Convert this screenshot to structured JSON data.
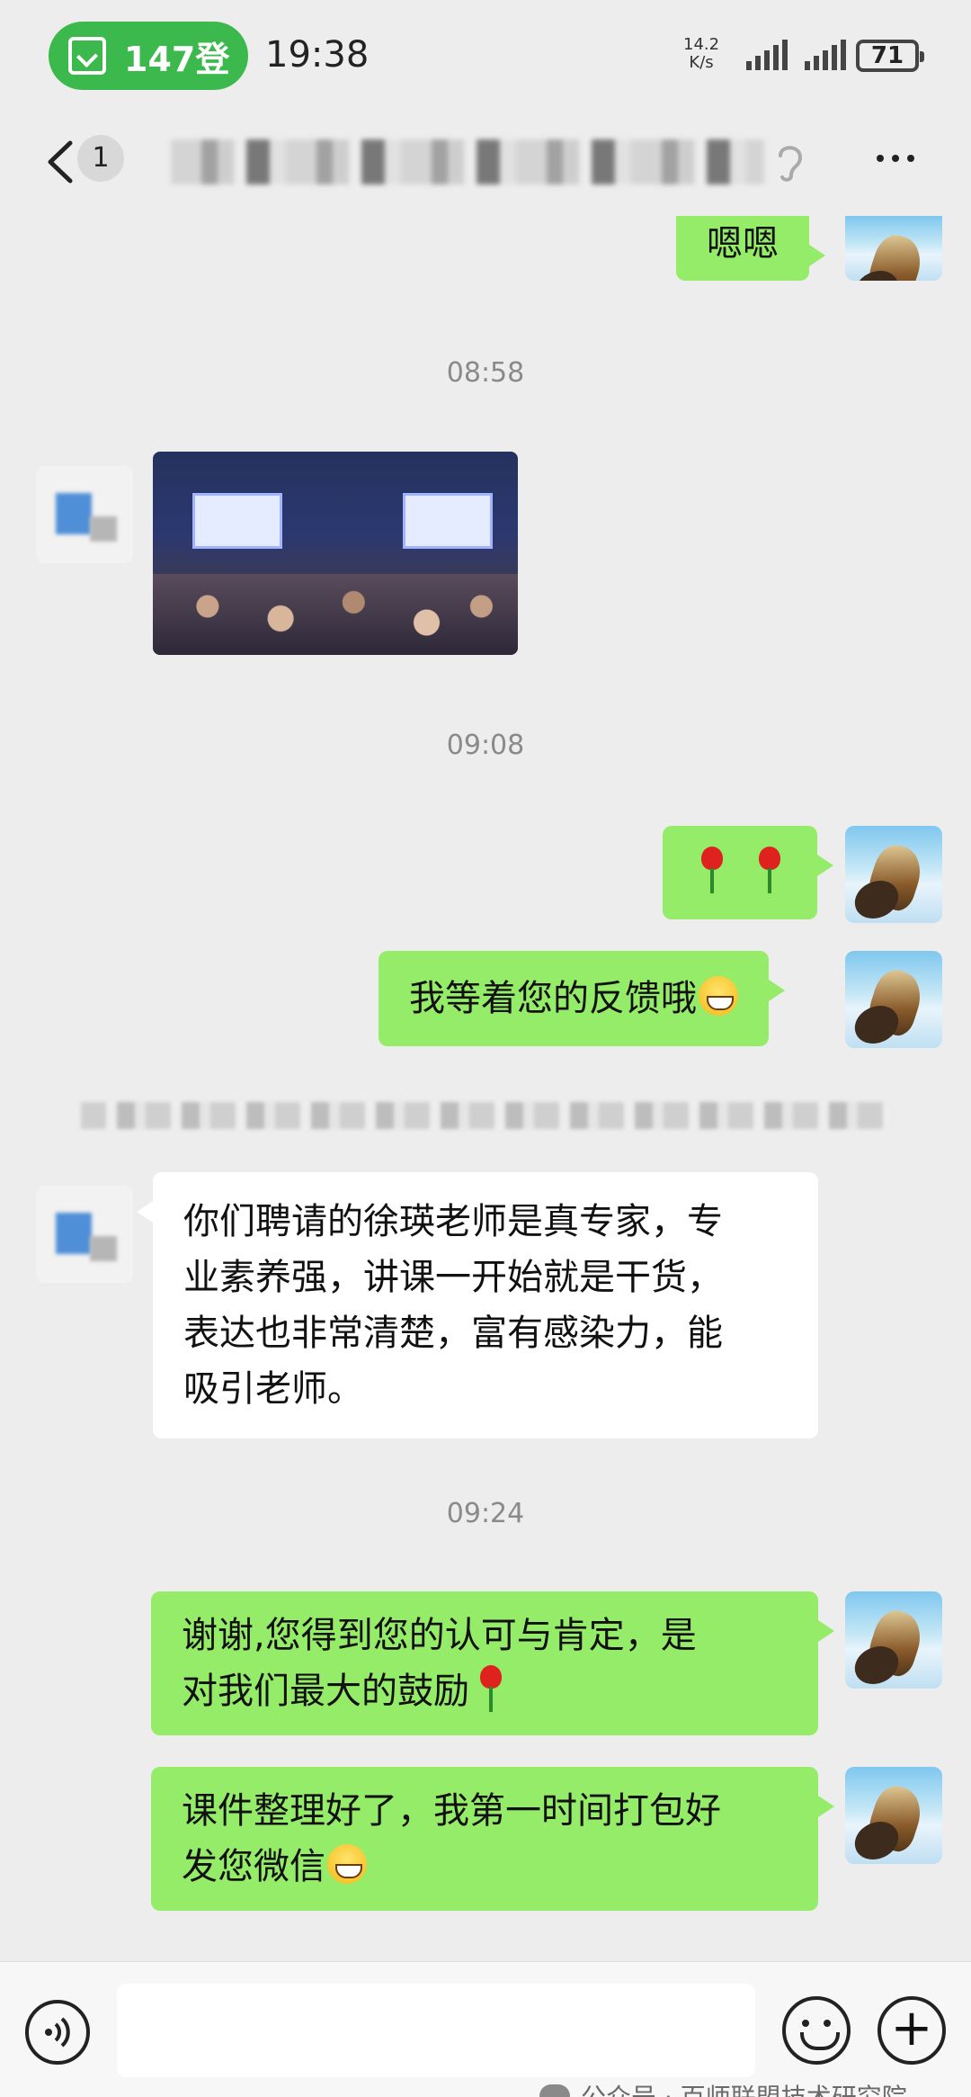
{
  "status_bar": {
    "call_pill": "147登",
    "time": "19:38",
    "net_speed_value": "14.2",
    "net_speed_unit": "K/s",
    "battery": "71"
  },
  "nav": {
    "unread_count": "1",
    "chat_title": "(模糊处理)"
  },
  "messages": [
    {
      "type": "text",
      "from": "me",
      "text": "嗯嗯"
    },
    {
      "type": "time",
      "text": "08:58"
    },
    {
      "type": "image",
      "from": "other"
    },
    {
      "type": "time",
      "text": "09:08"
    },
    {
      "type": "text",
      "from": "me",
      "text": "🌹🌹"
    },
    {
      "type": "text",
      "from": "me",
      "text": "我等着您的反馈哦"
    },
    {
      "type": "text",
      "from": "other",
      "lines": [
        "你们聘请的徐瑛老师是真专家，专",
        "业素养强，讲课一开始就是干货，",
        "表达也非常清楚，富有感染力，能",
        "吸引老师。"
      ]
    },
    {
      "type": "time",
      "text": "09:24"
    },
    {
      "type": "text",
      "from": "me",
      "lines": [
        "谢谢,您得到您的认可与肯定，是",
        "对我们最大的鼓励"
      ]
    },
    {
      "type": "text",
      "from": "me",
      "lines": [
        "课件整理好了，我第一时间打包好",
        "发您微信"
      ]
    }
  ],
  "input_bar": {
    "placeholder": "",
    "watermark": "公众号 · 百师联盟技术研究院"
  },
  "colors": {
    "my_bubble": "#95ec69",
    "other_bubble": "#ffffff",
    "background": "#ededed",
    "pill": "#3cb94d"
  }
}
